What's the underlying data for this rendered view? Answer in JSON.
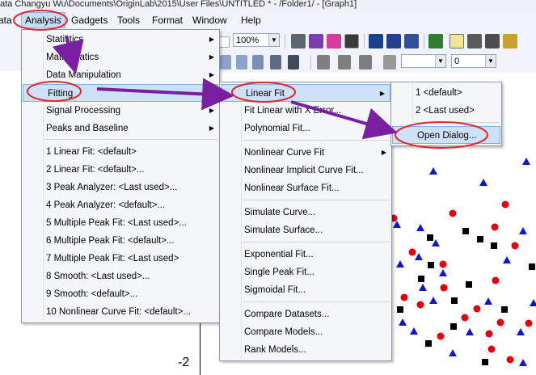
{
  "window": {
    "title": "ata  Changyu Wu\\Documents\\OriginLab\\2015\\User Files\\UNTITLED * - /Folder1/ - [Graph1]"
  },
  "menubar": {
    "items": [
      "ata",
      "Analysis",
      "Gadgets",
      "Tools",
      "Format",
      "Window",
      "Help"
    ]
  },
  "toolbar": {
    "zoom_value": "100%",
    "size_value": "0"
  },
  "analysis_menu": {
    "items": [
      {
        "label": "Statistics",
        "submenu": true
      },
      {
        "label": "Mathematics",
        "submenu": true
      },
      {
        "label": "Data Manipulation",
        "submenu": true
      },
      {
        "label": "Fitting",
        "submenu": true
      },
      {
        "label": "Signal Processing",
        "submenu": true
      },
      {
        "label": "Peaks and Baseline",
        "submenu": true
      },
      {
        "label": "1 Linear Fit: <default>",
        "submenu": false
      },
      {
        "label": "2 Linear Fit: <default>...",
        "submenu": false
      },
      {
        "label": "3 Peak Analyzer: <Last used>...",
        "submenu": false
      },
      {
        "label": "4 Peak Analyzer: <default>...",
        "submenu": false
      },
      {
        "label": "5 Multiple Peak Fit: <Last used>...",
        "submenu": false
      },
      {
        "label": "6 Multiple Peak Fit: <default>...",
        "submenu": false
      },
      {
        "label": "7 Multiple Peak Fit: <Last used>",
        "submenu": false
      },
      {
        "label": "8 Smooth: <Last used>...",
        "submenu": false
      },
      {
        "label": "9 Smooth: <default>...",
        "submenu": false
      },
      {
        "label": "10 Nonlinear Curve Fit: <default>...",
        "submenu": false
      }
    ]
  },
  "fitting_menu": {
    "items": [
      {
        "label": "Linear Fit",
        "submenu": true
      },
      {
        "label": "Fit Linear with X Error...",
        "submenu": false
      },
      {
        "label": "Polynomial Fit...",
        "submenu": false
      },
      {
        "label": "Nonlinear Curve Fit",
        "submenu": true
      },
      {
        "label": "Nonlinear Implicit Curve Fit...",
        "submenu": false
      },
      {
        "label": "Nonlinear Surface Fit...",
        "submenu": false
      },
      {
        "label": "Simulate Curve...",
        "submenu": false
      },
      {
        "label": "Simulate Surface...",
        "submenu": false
      },
      {
        "label": "Exponential Fit...",
        "submenu": false
      },
      {
        "label": "Single Peak Fit...",
        "submenu": false
      },
      {
        "label": "Sigmoidal Fit...",
        "submenu": false
      },
      {
        "label": "Compare Datasets...",
        "submenu": false
      },
      {
        "label": "Compare Models...",
        "submenu": false
      },
      {
        "label": "Rank Models...",
        "submenu": false
      }
    ]
  },
  "linear_fit_menu": {
    "items": [
      {
        "label": "1 <default>"
      },
      {
        "label": "2 <Last used>"
      },
      {
        "label": "Open Dialog..."
      }
    ]
  },
  "graph": {
    "tick_label": "-2"
  },
  "colors": {
    "highlight": "#cde1fa",
    "annotation": "#e2262c",
    "arrow": "#7b1fa2",
    "marker_red": "#e3000b",
    "marker_blue": "#1515c8",
    "marker_black": "#000000"
  }
}
